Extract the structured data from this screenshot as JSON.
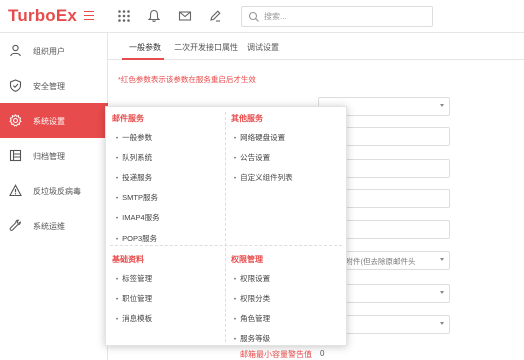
{
  "app": {
    "logo": "TurboEx"
  },
  "search": {
    "placeholder": "搜索..."
  },
  "sidebar": {
    "items": [
      {
        "label": "组织用户",
        "icon": "user-icon"
      },
      {
        "label": "安全管理",
        "icon": "shield-icon"
      },
      {
        "label": "系统设置",
        "icon": "gear-icon",
        "active": true
      },
      {
        "label": "归档管理",
        "icon": "archive-icon"
      },
      {
        "label": "反垃圾反病毒",
        "icon": "warning-icon"
      },
      {
        "label": "系统运维",
        "icon": "wrench-icon"
      }
    ]
  },
  "tabs": [
    {
      "label": "一般参数",
      "active": true
    },
    {
      "label": "二次开发接口属性"
    },
    {
      "label": "调试设置"
    }
  ],
  "main": {
    "notice": "*红色参数表示该参数在服务重启后才生效",
    "fields": [
      {
        "value": ""
      },
      {
        "value": ""
      },
      {
        "value": ""
      },
      {
        "value": ""
      },
      {
        "value": ""
      },
      {
        "value": "邮件作附件(但去除原邮件头"
      },
      {
        "value": ""
      },
      {
        "value": ""
      }
    ],
    "bottom_label": "邮箱最小容量警告值",
    "bottom_value": "0"
  },
  "menu": {
    "sections": [
      {
        "title": "邮件服务",
        "items": [
          "一般参数",
          "队列系统",
          "投递服务",
          "SMTP服务",
          "IMAP4服务",
          "POP3服务"
        ]
      },
      {
        "title": "其他服务",
        "items": [
          "网络硬盘设置",
          "公告设置",
          "自定义组件列表"
        ]
      },
      {
        "title": "基础资料",
        "items": [
          "标签管理",
          "职位管理",
          "消息模板"
        ]
      },
      {
        "title": "权限管理",
        "items": [
          "权限设置",
          "权限分类",
          "角色管理",
          "服务等级"
        ]
      }
    ]
  },
  "colors": {
    "accent": "#e84b4b"
  }
}
